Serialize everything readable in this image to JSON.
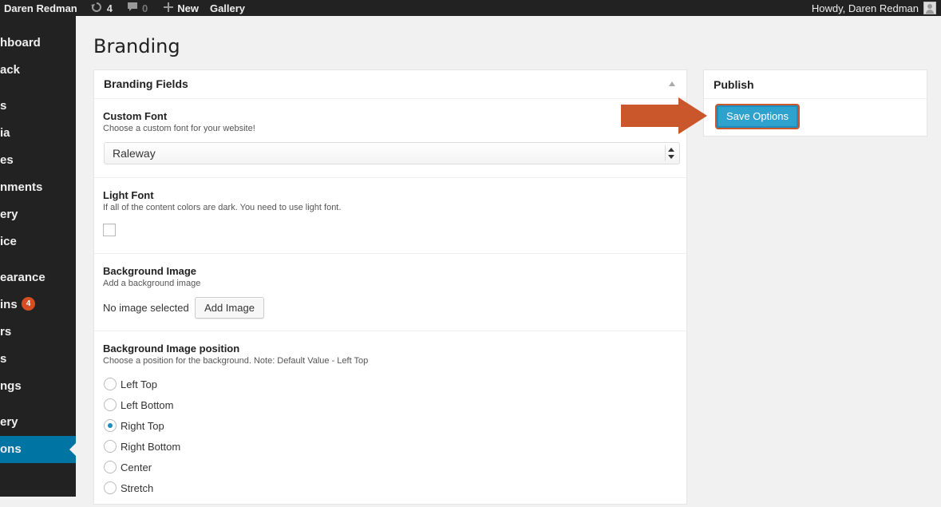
{
  "adminbar": {
    "site_name": "Daren Redman",
    "updates_icon": "refresh-icon",
    "updates_count": "4",
    "comments_icon": "comment-icon",
    "comments_count": "0",
    "new_icon": "plus-icon",
    "new_label": "New",
    "gallery_label": "Gallery",
    "howdy": "Howdy, Daren Redman"
  },
  "sidebar": {
    "items": [
      {
        "label": "hboard"
      },
      {
        "label": "ack"
      },
      {
        "label": "s"
      },
      {
        "label": "ia"
      },
      {
        "label": "es"
      },
      {
        "label": "nments"
      },
      {
        "label": "ery"
      },
      {
        "label": "ice"
      },
      {
        "label": "earance"
      },
      {
        "label": "ins",
        "badge": "4"
      },
      {
        "label": "rs"
      },
      {
        "label": "s"
      },
      {
        "label": "ngs"
      },
      {
        "label": "ery"
      },
      {
        "label": "ons"
      }
    ],
    "active_color": "#0074a2"
  },
  "page": {
    "title": "Branding"
  },
  "branding": {
    "panel_title": "Branding Fields",
    "custom_font": {
      "label": "Custom Font",
      "description": "Choose a custom font for your website!",
      "value": "Raleway"
    },
    "light_font": {
      "label": "Light Font",
      "description": "If all of the content colors are dark. You need to use light font.",
      "checked": false
    },
    "background_image": {
      "label": "Background Image",
      "description": "Add a background image",
      "status": "No image selected",
      "button": "Add Image"
    },
    "background_position": {
      "label": "Background Image position",
      "description": "Choose a position for the background. Note: Default Value - Left Top",
      "options": [
        "Left Top",
        "Left Bottom",
        "Right Top",
        "Right Bottom",
        "Center",
        "Stretch"
      ],
      "selected": "Right Top"
    }
  },
  "publish": {
    "title": "Publish",
    "save_label": "Save Options",
    "save_color": "#2ea2cc",
    "annotation_arrow_color": "#c9572b"
  }
}
